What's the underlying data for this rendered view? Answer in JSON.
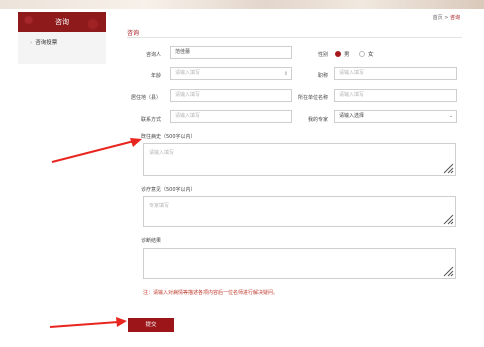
{
  "sidebar": {
    "header": "咨询",
    "items": [
      {
        "label": "咨询投票"
      }
    ]
  },
  "breadcrumb": {
    "home": "首页",
    "separator": ">",
    "current": "咨询"
  },
  "page_title": "咨询",
  "form": {
    "name": {
      "label": "咨询人",
      "value": "范佳蕾"
    },
    "gender": {
      "label": "性别",
      "options": [
        "男",
        "女"
      ],
      "selected": "男"
    },
    "age": {
      "label": "年龄",
      "placeholder": "请输入填写"
    },
    "occupation": {
      "label": "职称",
      "placeholder": "请输入填写"
    },
    "residence": {
      "label": "居住地（县）",
      "placeholder": "请输入填写"
    },
    "workplace": {
      "label": "所在单位名称",
      "placeholder": "请输入填写"
    },
    "contact": {
      "label": "联系方式",
      "placeholder": "请输入填写"
    },
    "expert": {
      "label": "我的专家",
      "placeholder": "请输入选择"
    },
    "history": {
      "label": "既往病史（500字以内）",
      "placeholder": "请输入填写"
    },
    "opinion": {
      "label": "诊疗意见（500字以内）",
      "placeholder": "专家填写"
    },
    "diagnosis": {
      "label": "诊断结果"
    }
  },
  "note": "注：请输入对病情等描述各项内容后一位名师进行解决疑问。",
  "submit_label": "提交"
}
